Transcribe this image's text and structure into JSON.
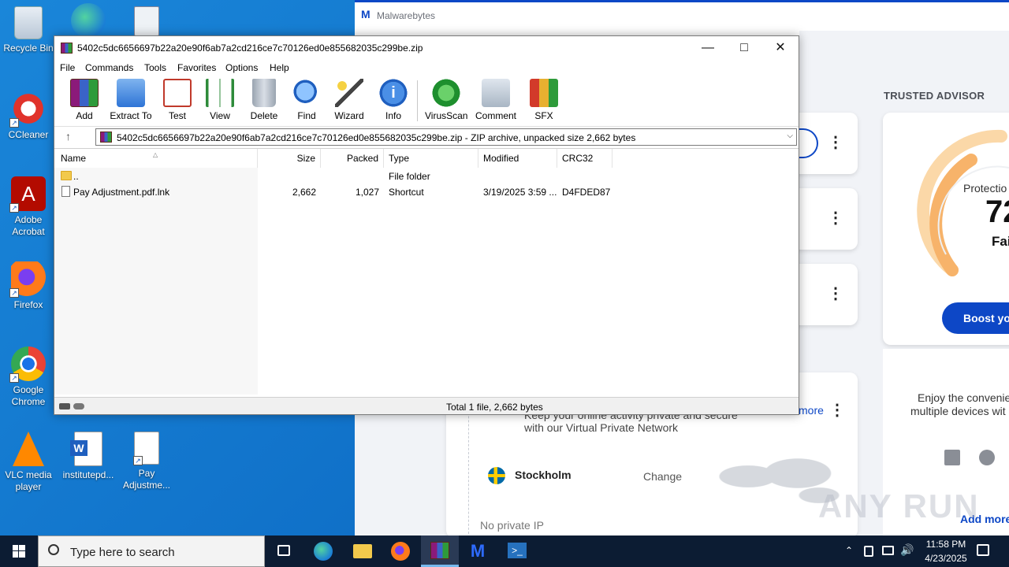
{
  "desktop": {
    "icons": [
      {
        "label": "Recycle Bin"
      },
      {
        "label": "CCleaner"
      },
      {
        "label": "Adobe Acrobat"
      },
      {
        "label": "Firefox"
      },
      {
        "label": "Google Chrome"
      },
      {
        "label": "VLC media player"
      },
      {
        "label": "institutepd..."
      },
      {
        "label": "Pay Adjustme..."
      }
    ]
  },
  "malwarebytes": {
    "title": "Malwarebytes",
    "trusted_advisor": "TRUSTED ADVISOR",
    "protection_label": "Protectio",
    "protection_score": "72",
    "protection_rating": "Fai",
    "boost_button": "Boost you",
    "enjoy_text_1": "Enjoy the convenie",
    "enjoy_text_2": "multiple devices wit",
    "vpn_line_1": "Keep your online activity private and secure",
    "vpn_line_2": "with our Virtual Private Network",
    "learn_more": "more",
    "location": "Stockholm",
    "change": "Change",
    "no_private_ip": "No private IP",
    "add_more": "Add more",
    "watermark": "ANY RUN"
  },
  "winrar": {
    "title": "5402c5dc6656697b22a20e90f6ab7a2cd216ce7c70126ed0e855682035c299be.zip",
    "menu": [
      "File",
      "Commands",
      "Tools",
      "Favorites",
      "Options",
      "Help"
    ],
    "tools": [
      "Add",
      "Extract To",
      "Test",
      "View",
      "Delete",
      "Find",
      "Wizard",
      "Info",
      "VirusScan",
      "Comment",
      "SFX"
    ],
    "address": "5402c5dc6656697b22a20e90f6ab7a2cd216ce7c70126ed0e855682035c299be.zip - ZIP archive, unpacked size 2,662 bytes",
    "columns": [
      "Name",
      "Size",
      "Packed",
      "Type",
      "Modified",
      "CRC32"
    ],
    "rows": [
      {
        "name": "..",
        "size": "",
        "packed": "",
        "type": "File folder",
        "modified": "",
        "crc": ""
      },
      {
        "name": "Pay Adjustment.pdf.lnk",
        "size": "2,662",
        "packed": "1,027",
        "type": "Shortcut",
        "modified": "3/19/2025 3:59 ...",
        "crc": "D4FDED87"
      }
    ],
    "status": "Total 1 file, 2,662 bytes"
  },
  "taskbar": {
    "search_placeholder": "Type here to search",
    "time": "11:58 PM",
    "date": "4/23/2025"
  }
}
